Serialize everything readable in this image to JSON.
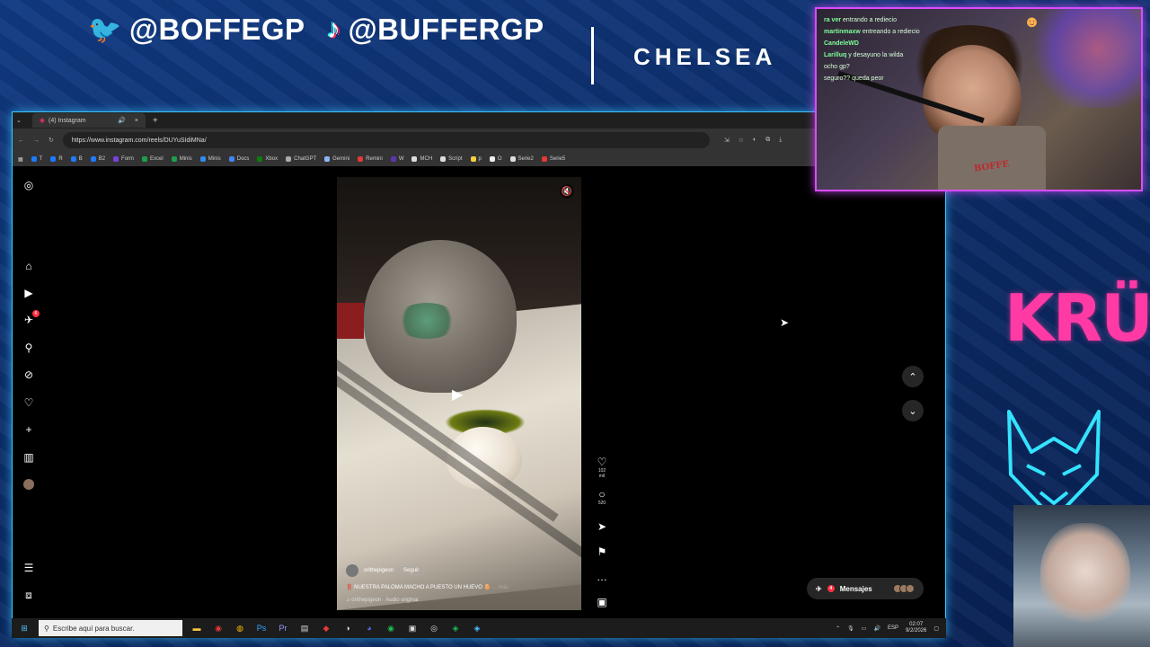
{
  "overlay": {
    "twitter_handle": "@BOFFEGP",
    "tiktok_handle": "@BUFFERGP",
    "team_name": "CHELSEA",
    "brand_logo_text": "KRÜ",
    "apron_text": "BOFFE",
    "colors": {
      "twitter": "#35a8ff",
      "kru_pink": "#ff3aa5",
      "webcam_border": "#d84dff",
      "browser_border": "#39c7ff"
    }
  },
  "chat": [
    {
      "user": "ra ver",
      "text": "entrando a rediecio"
    },
    {
      "user": "martinmaxw",
      "text": "entreando a rediecio"
    },
    {
      "user": "CandeleWD",
      "text": ""
    },
    {
      "user": "Larilluq",
      "text": "y desayuno la wilda"
    },
    {
      "user": "",
      "text": "ocho gp?"
    },
    {
      "user": "",
      "text": "seguro?? queda peor"
    }
  ],
  "browser": {
    "tab_title": "(4) Instagram",
    "url": "https://www.instagram.com/reels/DUYuSIdiMNa/",
    "bookmarks": [
      "T",
      "R",
      "B",
      "B2",
      "Form",
      "Excel",
      "Minis",
      "Minis",
      "Docs",
      "Xbox",
      "ChatGPT",
      "Gemini",
      "Remini",
      "W",
      "MCH",
      "Script",
      "p",
      "O",
      "Serie2",
      "Serie5"
    ]
  },
  "reel": {
    "username": "orithepigeon",
    "follow_label": "Seguir",
    "caption": "‼️ NUESTRA PALOMA MACHO A PUESTO UN HUEVO 🥚",
    "more_label": "... más",
    "audio": "orithepigeon · Audio original",
    "likes": "102 mil",
    "comments": "520"
  },
  "messages": {
    "label": "Mensajes",
    "badge": "4"
  },
  "notifications_badge": "6",
  "taskbar": {
    "search_placeholder": "Escribe aquí para buscar.",
    "language": "ESP",
    "time": "02:07",
    "date": "9/2/2026"
  }
}
